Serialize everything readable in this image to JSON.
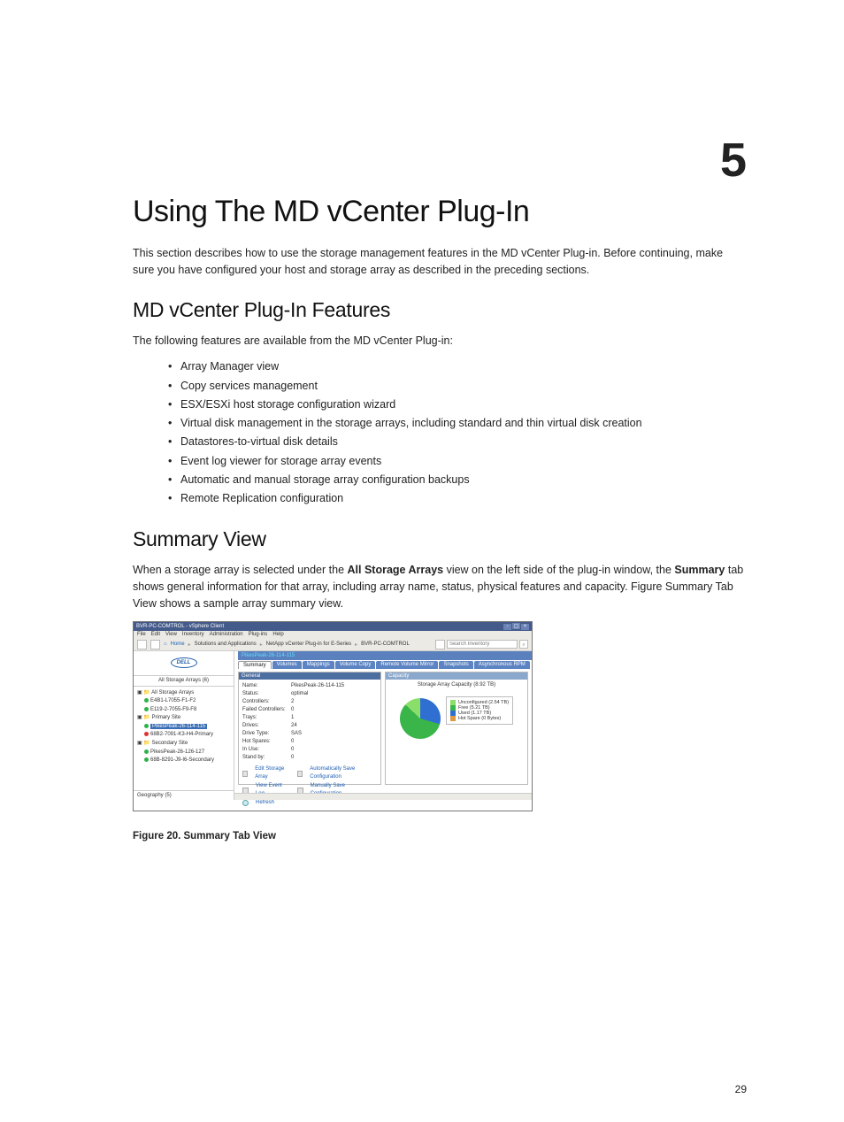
{
  "chapterNumber": "5",
  "pageTitle": "Using The MD vCenter Plug-In",
  "intro": "This section describes how to use the storage management features in the MD vCenter Plug-in. Before continuing, make sure you have configured your host and storage array as described in the preceding sections.",
  "section1": {
    "heading": "MD vCenter Plug-In Features",
    "lead": "The following features are available from the MD vCenter Plug-in:",
    "features": [
      "Array Manager view",
      "Copy services management",
      "ESX/ESXi host storage configuration wizard",
      "Virtual disk management in the storage arrays, including standard and thin virtual disk creation",
      "Datastores-to-virtual disk details",
      "Event log viewer for storage array events",
      "Automatic and manual storage array configuration backups",
      "Remote Replication configuration"
    ]
  },
  "section2": {
    "heading": "Summary View",
    "body_pre": "When a storage array is selected under the ",
    "body_b1": "All Storage Arrays",
    "body_mid": " view on the left side of the plug-in window, the ",
    "body_b2": "Summary",
    "body_post": " tab shows general information for that array, including array name, status, physical features and capacity. Figure Summary Tab View shows a sample array summary view."
  },
  "screenshot": {
    "windowTitle": "BVR-PC-COMTROL - vSphere Client",
    "menubar": [
      "File",
      "Edit",
      "View",
      "Inventory",
      "Administration",
      "Plug-ins",
      "Help"
    ],
    "breadcrumb": {
      "home": "Home",
      "node1": "Solutions and Applications",
      "node2": "NetApp vCenter Plug-in for E-Series",
      "node3": "BVR-PC-COMTROL"
    },
    "searchPlaceholder": "Search Inventory",
    "logo": "DELL",
    "arraysHeader": "All Storage Arrays (6)",
    "tree": {
      "root": "All Storage Arrays",
      "item1": "E4B1-L7055-F1-F2",
      "item2": "E119-2-7055-F9-F8",
      "folder1": "Primary Site",
      "item3sel": "PikesPeak-26-114-115",
      "item4": "68B2-7091-K3-H4-Primary",
      "folder2": "Secondary Site",
      "item5": "PikesPeak-26-126-127",
      "item6": "68B-8291-J9-I6-Secondary"
    },
    "geoFooter": "Geography (5)",
    "selbar": "PikesPeak-26-114-115",
    "tabs": [
      "Summary",
      "Volumes",
      "Mappings",
      "Volume Copy",
      "Remote Volume Mirror",
      "Snapshots",
      "Asynchronous RPM"
    ],
    "general": {
      "title": "General",
      "rows": {
        "Name": "PikesPeak-26-114-115",
        "Status": "optimal",
        "Controllers": "2",
        "FailedControllers": "0",
        "Trays": "1",
        "Drives": "24",
        "DriveType": "SAS",
        "HotSpares": "0",
        "InUse": "0",
        "StandBy": "0"
      },
      "labels": {
        "Name": "Name:",
        "Status": "Status:",
        "Controllers": "Controllers:",
        "FailedControllers": "Failed Controllers:",
        "Trays": "Trays:",
        "Drives": "Drives:",
        "DriveType": "Drive Type:",
        "HotSpares": "Hot Spares:",
        "InUse": "In Use:",
        "StandBy": "Stand by:"
      },
      "links": {
        "edit": "Edit Storage Array",
        "autosave": "Automatically Save Configuration",
        "viewlog": "View Event Log",
        "manualsave": "Manually Save Configuration",
        "refresh": "Refresh"
      }
    },
    "capacity": {
      "title": "Capacity",
      "heading": "Storage Array Capacity (8.92 TB)",
      "legend": {
        "unconfigured": "Unconfigured (2.54 TB)",
        "free": "Free (5.21 TB)",
        "used": "Used (1.17 TB)",
        "hotspare": "Hot Spare (0 Bytes)"
      }
    }
  },
  "chart_data": {
    "type": "pie",
    "title": "Storage Array Capacity (8.92 TB)",
    "categories": [
      "Unconfigured",
      "Free",
      "Used",
      "Hot Spare"
    ],
    "values": [
      2.54,
      5.21,
      1.17,
      0
    ],
    "unit": "TB"
  },
  "figCaption": "Figure 20. Summary Tab View",
  "pageNumber": "29"
}
